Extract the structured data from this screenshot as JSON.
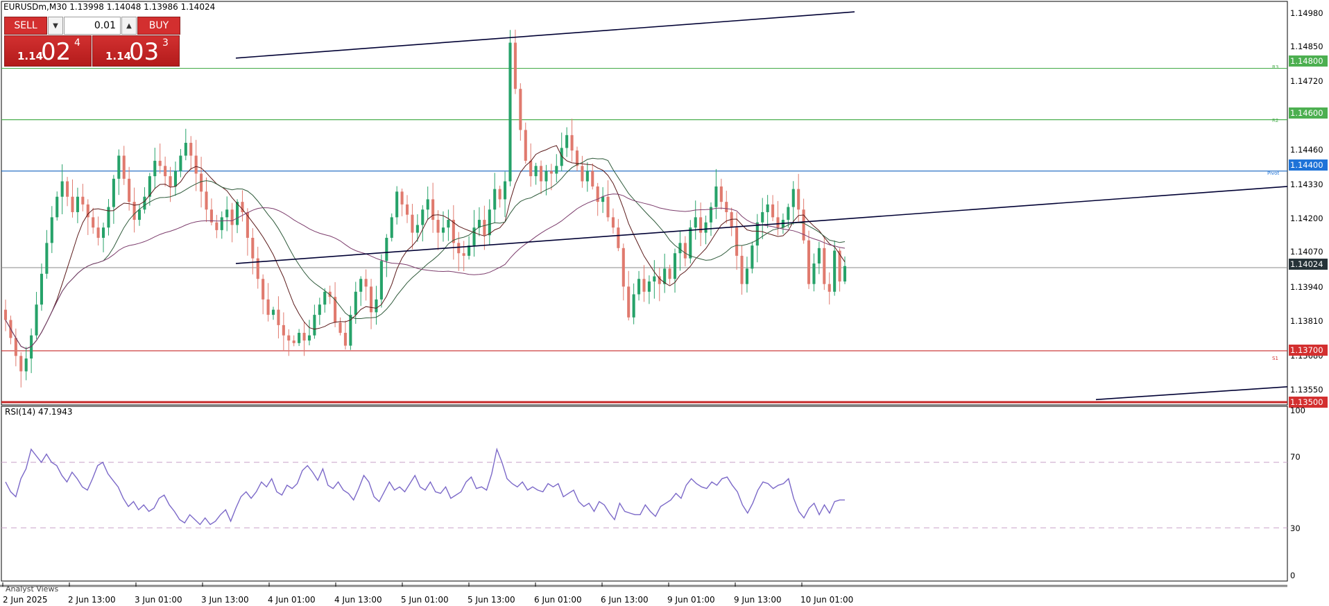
{
  "window": {
    "title": "EURUSDm,M30  1.13998 1.14048 1.13986 1.14024",
    "symbol": "EURUSDm",
    "timeframe": "M30"
  },
  "trade_panel": {
    "sell_label": "SELL",
    "buy_label": "BUY",
    "lot_value": "0.01",
    "sell_price": {
      "small": "1.14",
      "big": "02",
      "sup": "4"
    },
    "buy_price": {
      "small": "1.14",
      "big": "03",
      "sup": "3"
    },
    "colors": {
      "button": "#d32f2f"
    }
  },
  "price_axis": {
    "ticks": [
      "1.14980",
      "1.14850",
      "1.14720",
      "1.14460",
      "1.14330",
      "1.14200",
      "1.14070",
      "1.13940",
      "1.13810",
      "1.13680",
      "1.13550"
    ],
    "current_price": "1.14024"
  },
  "levels": [
    {
      "name": "R3",
      "value": "1.14800",
      "color": "#4caf50"
    },
    {
      "name": "R2",
      "value": "1.14600",
      "color": "#4caf50"
    },
    {
      "name": "Pivot",
      "value": "1.14400",
      "color": "#1565c0"
    },
    {
      "name": "S1",
      "value": "1.13700",
      "color": "#c62828"
    },
    {
      "name": "",
      "value": "1.13500",
      "color": "#c62828"
    }
  ],
  "rsi": {
    "title": "RSI(14) 47.1943",
    "ticks": [
      "100",
      "70",
      "30",
      "0"
    ]
  },
  "time_axis": {
    "labels": [
      "2 Jun 2025",
      "2 Jun 13:00",
      "3 Jun 01:00",
      "3 Jun 13:00",
      "4 Jun 01:00",
      "4 Jun 13:00",
      "5 Jun 01:00",
      "5 Jun 13:00",
      "6 Jun 01:00",
      "6 Jun 13:00",
      "9 Jun 01:00",
      "9 Jun 13:00",
      "10 Jun 01:00"
    ]
  },
  "bottom_tabs": {
    "analyst_views": "Analyst Views"
  },
  "chart_data": [
    {
      "type": "candlestick",
      "title": "EURUSDm,M30",
      "ylim": [
        1.135,
        1.1505
      ],
      "closes": [
        1.1382,
        1.1375,
        1.1368,
        1.1362,
        1.1367,
        1.1376,
        1.1388,
        1.14,
        1.1412,
        1.1422,
        1.143,
        1.1436,
        1.143,
        1.1424,
        1.143,
        1.1427,
        1.1422,
        1.1418,
        1.1414,
        1.1418,
        1.1426,
        1.1437,
        1.1446,
        1.1437,
        1.1428,
        1.1421,
        1.1425,
        1.143,
        1.1438,
        1.1444,
        1.1442,
        1.1438,
        1.1434,
        1.144,
        1.1446,
        1.1451,
        1.1446,
        1.1439,
        1.1432,
        1.1425,
        1.142,
        1.1417,
        1.1422,
        1.1425,
        1.1419,
        1.1428,
        1.1424,
        1.1414,
        1.1406,
        1.1398,
        1.139,
        1.1384,
        1.1386,
        1.138,
        1.1376,
        1.1374,
        1.1373,
        1.1377,
        1.1374,
        1.1376,
        1.1384,
        1.1388,
        1.1393,
        1.1391,
        1.1381,
        1.1377,
        1.1372,
        1.1384,
        1.1393,
        1.1398,
        1.1395,
        1.1385,
        1.139,
        1.1405,
        1.1414,
        1.1422,
        1.1432,
        1.1427,
        1.1423,
        1.1416,
        1.1419,
        1.1425,
        1.1429,
        1.1421,
        1.1416,
        1.1418,
        1.1421,
        1.1412,
        1.1408,
        1.1407,
        1.1411,
        1.1418,
        1.1421,
        1.1415,
        1.1425,
        1.1433,
        1.1429,
        1.1436,
        1.149,
        1.1472,
        1.1456,
        1.1444,
        1.1438,
        1.1442,
        1.1436,
        1.144,
        1.1439,
        1.1442,
        1.1449,
        1.1454,
        1.1448,
        1.1442,
        1.1436,
        1.144,
        1.1434,
        1.1428,
        1.143,
        1.1422,
        1.1418,
        1.141,
        1.1395,
        1.1383,
        1.1392,
        1.1398,
        1.1393,
        1.1397,
        1.1399,
        1.1396,
        1.1402,
        1.1398,
        1.1408,
        1.1412,
        1.1406,
        1.1418,
        1.1422,
        1.1416,
        1.142,
        1.1426,
        1.1434,
        1.1428,
        1.1424,
        1.1418,
        1.1407,
        1.1396,
        1.1402,
        1.1411,
        1.142,
        1.1424,
        1.1427,
        1.1422,
        1.1418,
        1.1421,
        1.1426,
        1.1433,
        1.1425,
        1.1413,
        1.1396,
        1.1404,
        1.141,
        1.1396,
        1.1393,
        1.1409,
        1.1397,
        1.1403
      ],
      "sma_fast": {
        "color": "#5b1a1a"
      },
      "sma_mid": {
        "color": "#2e5a3a"
      },
      "sma_slow": {
        "color": "#7b3b6b"
      },
      "trendlines": [
        {
          "from": [
            1.1484
          ],
          "to": [
            1.1502
          ],
          "color": "#000033"
        },
        {
          "from": [
            1.1404
          ],
          "to": [
            1.1434
          ],
          "color": "#000033"
        },
        {
          "from": [
            1.135
          ],
          "to": [
            1.1356
          ],
          "color": "#000033"
        }
      ]
    },
    {
      "type": "line",
      "title": "RSI(14) 47.1943",
      "ylim": [
        0,
        100
      ],
      "levels": [
        70,
        30
      ],
      "color": "#7b68c8",
      "values": [
        58,
        52,
        49,
        60,
        66,
        78,
        74,
        70,
        75,
        70,
        68,
        62,
        58,
        64,
        60,
        55,
        53,
        60,
        68,
        70,
        63,
        59,
        55,
        48,
        43,
        46,
        41,
        44,
        40,
        42,
        48,
        50,
        44,
        40,
        35,
        33,
        38,
        35,
        32,
        36,
        32,
        34,
        38,
        41,
        34,
        42,
        49,
        52,
        48,
        52,
        58,
        55,
        60,
        52,
        50,
        56,
        54,
        57,
        65,
        68,
        64,
        59,
        66,
        56,
        54,
        58,
        53,
        51,
        47,
        54,
        62,
        58,
        49,
        46,
        52,
        58,
        53,
        55,
        52,
        57,
        62,
        55,
        53,
        58,
        52,
        51,
        55,
        48,
        50,
        52,
        58,
        61,
        54,
        55,
        53,
        63,
        78,
        70,
        60,
        57,
        55,
        58,
        53,
        55,
        53,
        52,
        57,
        55,
        57,
        49,
        51,
        53,
        46,
        43,
        45,
        40,
        46,
        44,
        39,
        35,
        45,
        40,
        39,
        38,
        38,
        44,
        40,
        37,
        43,
        45,
        47,
        51,
        48,
        56,
        60,
        57,
        55,
        54,
        58,
        56,
        60,
        61,
        56,
        52,
        44,
        39,
        45,
        53,
        58,
        57,
        54,
        56,
        57,
        60,
        48,
        40,
        36,
        42,
        45,
        38,
        44,
        39,
        46,
        47,
        47
      ]
    }
  ]
}
